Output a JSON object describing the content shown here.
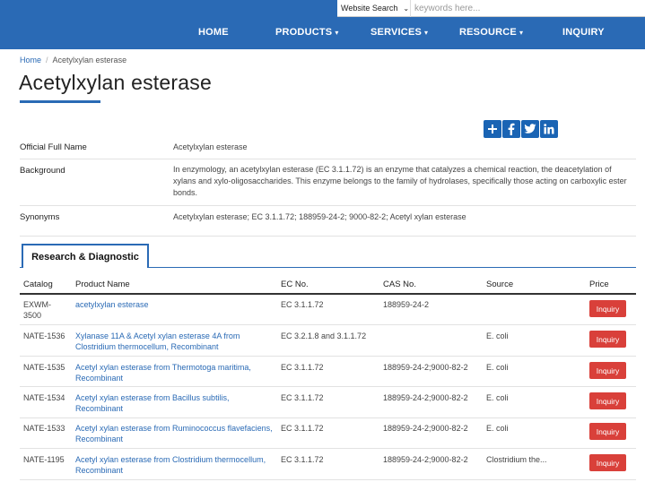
{
  "header": {
    "search": {
      "select_label": "Website Search",
      "placeholder": "keywords here..."
    },
    "nav": [
      {
        "label": "HOME",
        "caret": ""
      },
      {
        "label": "PRODUCTS",
        "caret": "▾"
      },
      {
        "label": "SERVICES",
        "caret": "▾"
      },
      {
        "label": "RESOURCE",
        "caret": "▾"
      },
      {
        "label": "INQUIRY",
        "caret": ""
      }
    ]
  },
  "breadcrumb": {
    "home": "Home",
    "separator": "/",
    "current": "Acetylxylan esterase"
  },
  "page_title": "Acetylxylan esterase",
  "share_icons": [
    "plus-icon",
    "facebook-icon",
    "twitter-icon",
    "linkedin-icon"
  ],
  "info": [
    {
      "label": "Official Full Name",
      "value": "Acetylxylan esterase"
    },
    {
      "label": "Background",
      "value": "In enzymology, an acetylxylan esterase (EC 3.1.1.72) is an enzyme that catalyzes a chemical reaction, the deacetylation of xylans and xylo-oligosaccharides. This enzyme belongs to the family of hydrolases, specifically those acting on carboxylic ester bonds."
    },
    {
      "label": "Synonyms",
      "value": "Acetylxylan esterase; EC 3.1.1.72; 188959-24-2; 9000-82-2; Acetyl xylan esterase"
    }
  ],
  "tab": {
    "label": "Research & Diagnostic"
  },
  "table": {
    "headers": [
      "Catalog",
      "Product Name",
      "EC No.",
      "CAS No.",
      "Source",
      "Price"
    ],
    "rows": [
      {
        "catalog": "EXWM-3500",
        "name": "acetylxylan esterase",
        "ec": "EC 3.1.1.72",
        "cas": "188959-24-2",
        "source": "",
        "button": "Inquiry"
      },
      {
        "catalog": "NATE-1536",
        "name": "Xylanase 11A & Acetyl xylan esterase 4A from Clostridium thermocellum, Recombinant",
        "ec": "EC 3.2.1.8 and 3.1.1.72",
        "cas": "",
        "source": "E. coli",
        "button": "Inquiry"
      },
      {
        "catalog": "NATE-1535",
        "name": "Acetyl xylan esterase from Thermotoga maritima, Recombinant",
        "ec": "EC 3.1.1.72",
        "cas": "188959-24-2;9000-82-2",
        "source": "E. coli",
        "button": "Inquiry"
      },
      {
        "catalog": "NATE-1534",
        "name": "Acetyl xylan esterase from Bacillus subtilis, Recombinant",
        "ec": "EC 3.1.1.72",
        "cas": "188959-24-2;9000-82-2",
        "source": "E. coli",
        "button": "Inquiry"
      },
      {
        "catalog": "NATE-1533",
        "name": "Acetyl xylan esterase from Ruminococcus flavefaciens, Recombinant",
        "ec": "EC 3.1.1.72",
        "cas": "188959-24-2;9000-82-2",
        "source": "E. coli",
        "button": "Inquiry"
      },
      {
        "catalog": "NATE-1195",
        "name": "Acetyl xylan esterase from Clostridium thermocellum, Recombinant",
        "ec": "EC 3.1.1.72",
        "cas": "188959-24-2;9000-82-2",
        "source": "Clostridium the...",
        "button": "Inquiry"
      }
    ]
  },
  "colors": {
    "brand_blue": "#2a6ab5",
    "inquiry_red": "#d9403a",
    "share_blue": "#1a64b4"
  }
}
